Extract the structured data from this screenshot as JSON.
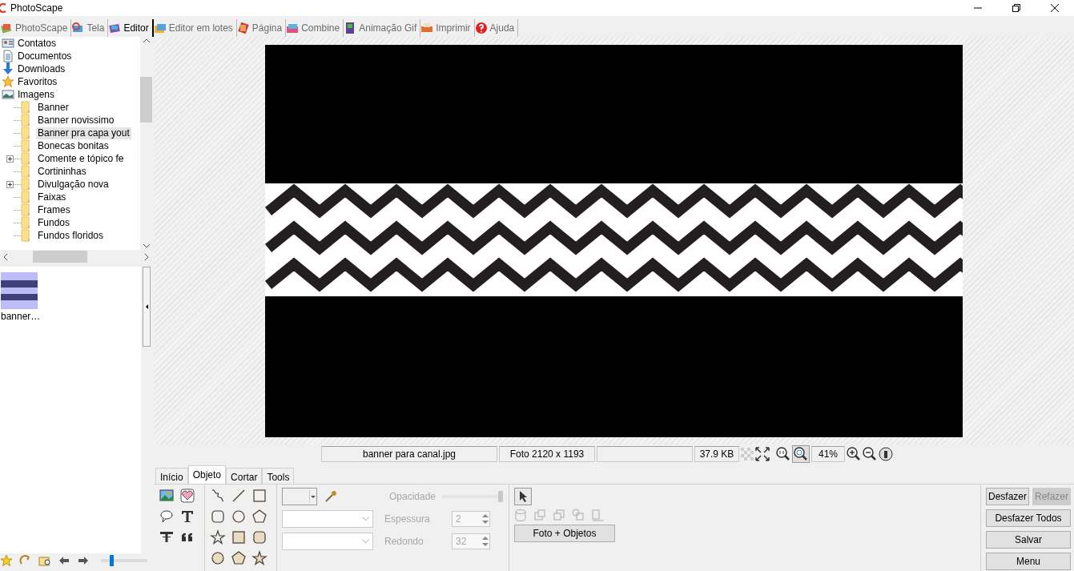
{
  "window": {
    "title": "PhotoScape"
  },
  "tabs": [
    {
      "label": "PhotoScape",
      "selected": false,
      "kind": "app"
    },
    {
      "label": "Tela",
      "selected": false,
      "kind": "screen"
    },
    {
      "label": "Editor",
      "selected": true,
      "kind": "editor"
    },
    {
      "label": "Editor em lotes",
      "selected": false,
      "kind": "batch"
    },
    {
      "label": "Página",
      "selected": false,
      "kind": "page"
    },
    {
      "label": "Combine",
      "selected": false,
      "kind": "combine"
    },
    {
      "label": "Animação Gif",
      "selected": false,
      "kind": "gif"
    },
    {
      "label": "Imprimir",
      "selected": false,
      "kind": "print"
    },
    {
      "label": "Ajuda",
      "selected": false,
      "kind": "help"
    }
  ],
  "folder_tree": {
    "items": [
      {
        "label": "Contatos",
        "kind": "contacts"
      },
      {
        "label": "Documentos",
        "kind": "documents"
      },
      {
        "label": "Downloads",
        "kind": "downloads"
      },
      {
        "label": "Favoritos",
        "kind": "favorites"
      },
      {
        "label": "Imagens",
        "kind": "pictures",
        "children": [
          {
            "label": "Banner",
            "selected": false,
            "expandable": false
          },
          {
            "label": "Banner novissimo",
            "selected": false,
            "expandable": false
          },
          {
            "label": "Banner pra capa yout",
            "selected": true,
            "expandable": false
          },
          {
            "label": "Bonecas bonitas",
            "selected": false,
            "expandable": false
          },
          {
            "label": "Comente e tópico fe",
            "selected": false,
            "expandable": true
          },
          {
            "label": "Cortininhas",
            "selected": false,
            "expandable": false
          },
          {
            "label": "Divulgação nova",
            "selected": false,
            "expandable": true
          },
          {
            "label": "Faixas",
            "selected": false,
            "expandable": false
          },
          {
            "label": "Frames",
            "selected": false,
            "expandable": false
          },
          {
            "label": "Fundos",
            "selected": false,
            "expandable": false
          },
          {
            "label": "Fundos floridos",
            "selected": false,
            "expandable": false
          }
        ]
      }
    ]
  },
  "thumbnails": [
    {
      "caption": "banner…"
    }
  ],
  "thumbnail_size": {
    "level": 0.2
  },
  "status_bar": {
    "file_name": "banner para canal.jpg",
    "dimensions": "Foto 2120 x 1193",
    "file_size": "37.9 KB",
    "zoom": "41%"
  },
  "editor_tabs": [
    {
      "label": "Início",
      "selected": false
    },
    {
      "label": "Objeto",
      "selected": true
    },
    {
      "label": "Cortar",
      "selected": false
    },
    {
      "label": "Tools",
      "selected": false
    }
  ],
  "object_properties": {
    "disabled": true,
    "opacity": {
      "label": "Opacidade",
      "level": 1
    },
    "thickness": {
      "label": "Espessura",
      "value": "2"
    },
    "rounding": {
      "label": "Redondo",
      "value": "32"
    }
  },
  "merge_button": "Foto + Objetos",
  "actions": [
    [
      {
        "label": "Desfazer",
        "disabled": false
      },
      {
        "label": "Refazer",
        "disabled": true
      }
    ],
    [
      {
        "label": "Desfazer Todos",
        "disabled": false
      }
    ],
    [
      {
        "label": "Salvar",
        "disabled": false
      }
    ],
    [
      {
        "label": "Menu",
        "disabled": false
      }
    ]
  ]
}
